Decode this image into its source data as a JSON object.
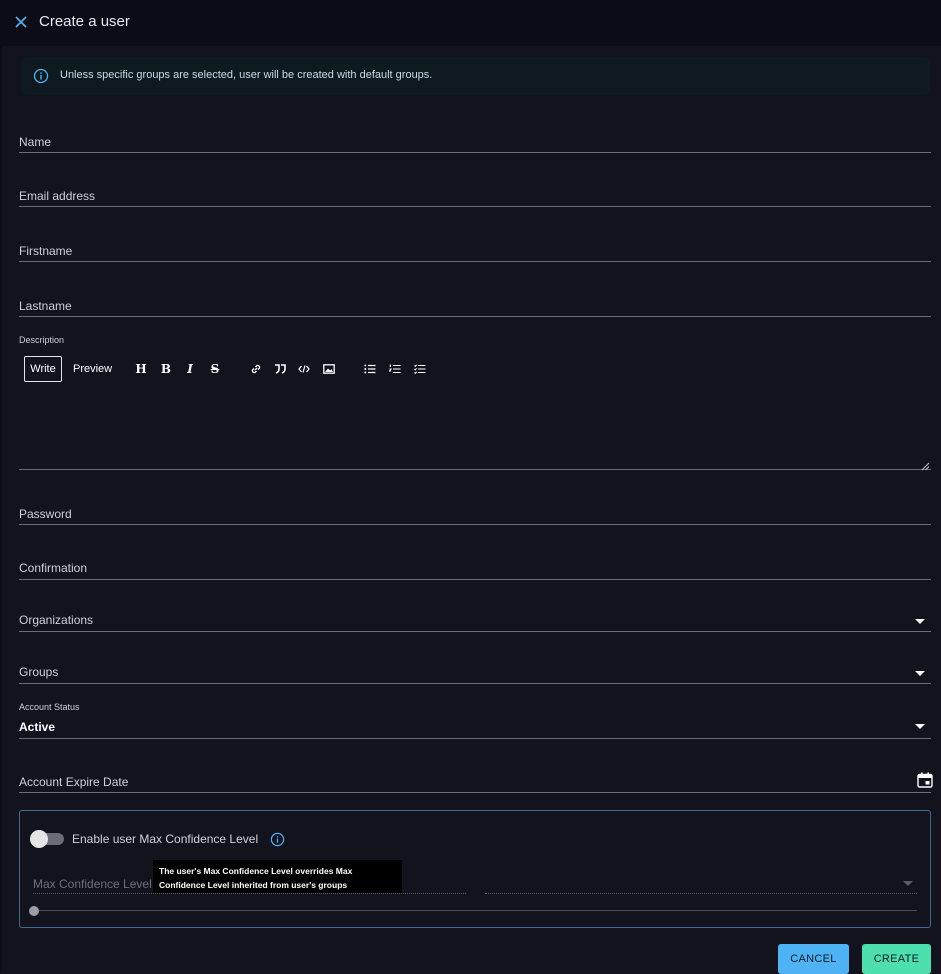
{
  "header": {
    "title": "Create a user",
    "close_icon": "close-icon"
  },
  "alert": {
    "icon": "info-icon",
    "text": "Unless specific groups are selected, user will be created with default groups."
  },
  "fields": {
    "name": "Name",
    "email": "Email address",
    "firstname": "Firstname",
    "lastname": "Lastname",
    "description": "Description",
    "password": "Password",
    "confirmation": "Confirmation",
    "organizations": "Organizations",
    "groups": "Groups",
    "account_status_label": "Account Status",
    "account_status_value": "Active",
    "account_expire_date": "Account Expire Date"
  },
  "editor": {
    "write": "Write",
    "preview": "Preview",
    "tools": [
      "heading-icon",
      "bold-icon",
      "italic-icon",
      "strikethrough-icon",
      "link-icon",
      "quote-icon",
      "code-icon",
      "image-icon",
      "bulleted-list-icon",
      "numbered-list-icon",
      "checklist-icon"
    ]
  },
  "confidence": {
    "toggle_label": "Enable user Max Confidence Level",
    "tooltip": "The user's Max Confidence Level overrides Max Confidence Level inherited from user's groups",
    "max_label": "Max Confidence Level",
    "toggle_on": false,
    "slider_value": 0
  },
  "buttons": {
    "cancel": "CANCEL",
    "create": "CREATE"
  },
  "colors": {
    "background": "#12131c",
    "header": "#0b0c14",
    "cancel": "#4eb3f5",
    "create": "#4de0ae",
    "accent_border": "#3d6a93"
  }
}
